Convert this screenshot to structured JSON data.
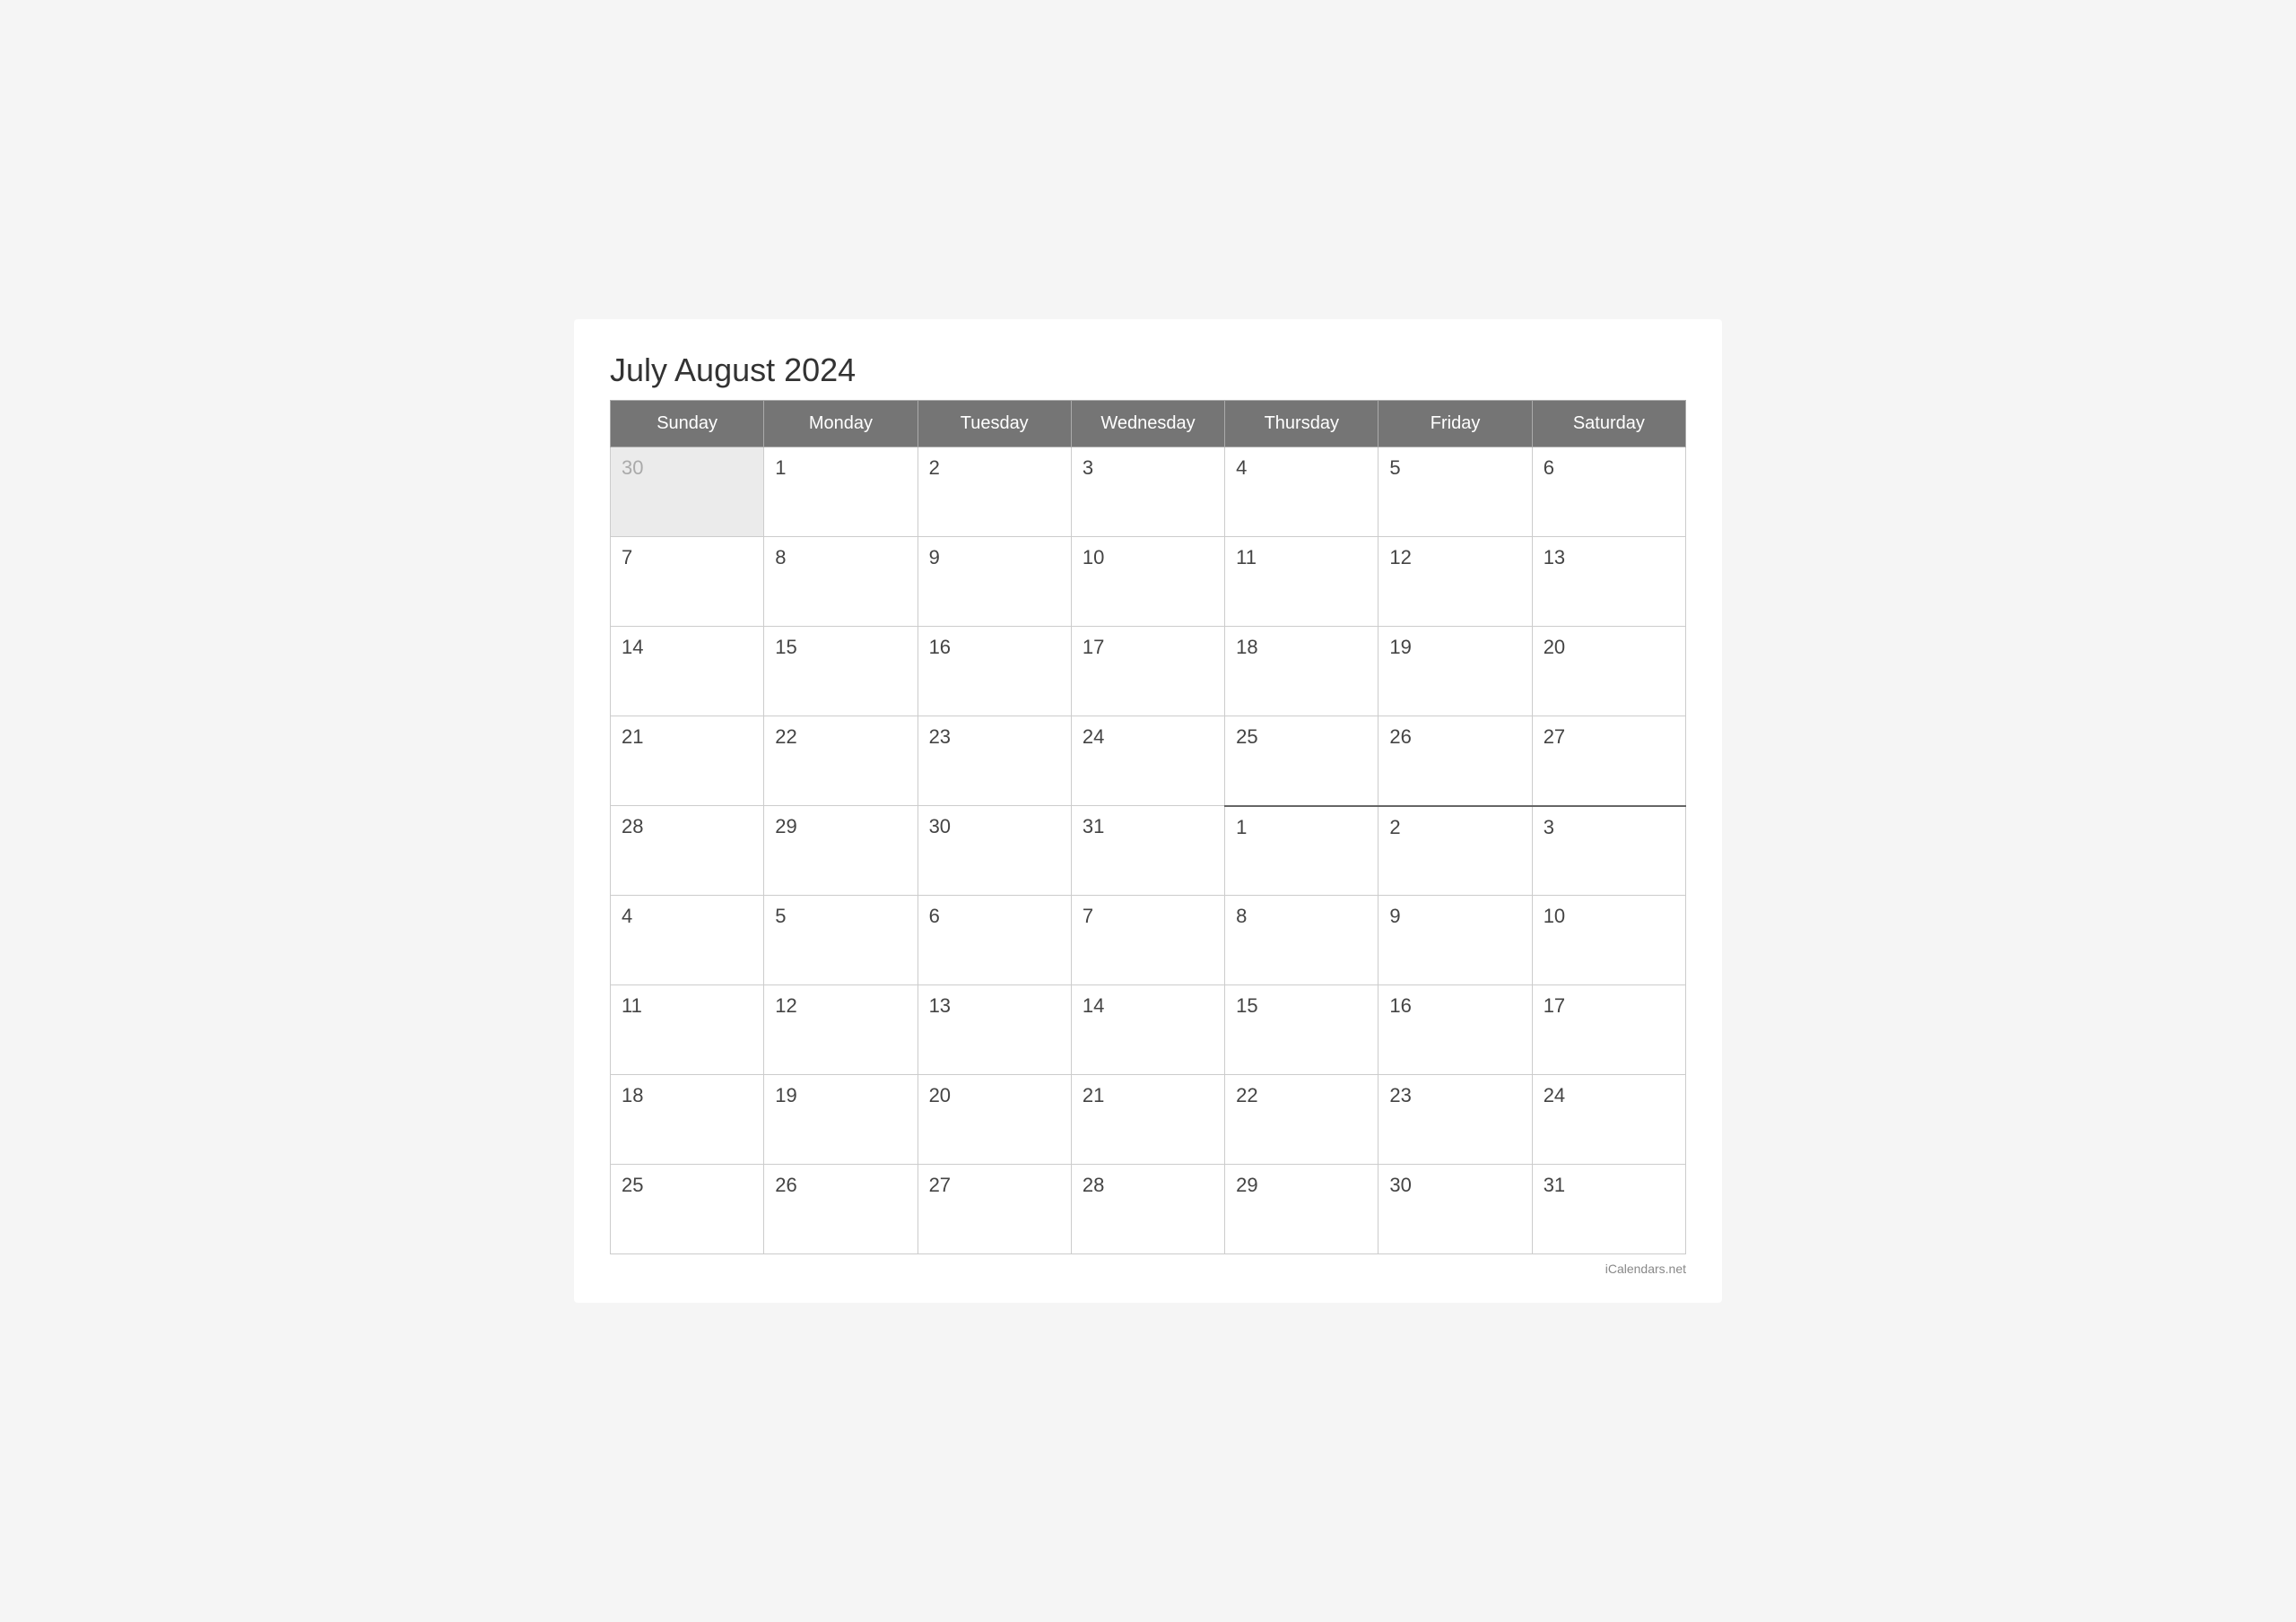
{
  "title": "July August 2024",
  "header": {
    "days": [
      "Sunday",
      "Monday",
      "Tuesday",
      "Wednesday",
      "Thursday",
      "Friday",
      "Saturday"
    ]
  },
  "weeks": [
    [
      {
        "day": "30",
        "otherMonth": true
      },
      {
        "day": "1",
        "otherMonth": false
      },
      {
        "day": "2",
        "otherMonth": false
      },
      {
        "day": "3",
        "otherMonth": false
      },
      {
        "day": "4",
        "otherMonth": false
      },
      {
        "day": "5",
        "otherMonth": false
      },
      {
        "day": "6",
        "otherMonth": false
      }
    ],
    [
      {
        "day": "7",
        "otherMonth": false
      },
      {
        "day": "8",
        "otherMonth": false
      },
      {
        "day": "9",
        "otherMonth": false
      },
      {
        "day": "10",
        "otherMonth": false
      },
      {
        "day": "11",
        "otherMonth": false
      },
      {
        "day": "12",
        "otherMonth": false
      },
      {
        "day": "13",
        "otherMonth": false
      }
    ],
    [
      {
        "day": "14",
        "otherMonth": false
      },
      {
        "day": "15",
        "otherMonth": false
      },
      {
        "day": "16",
        "otherMonth": false
      },
      {
        "day": "17",
        "otherMonth": false
      },
      {
        "day": "18",
        "otherMonth": false
      },
      {
        "day": "19",
        "otherMonth": false
      },
      {
        "day": "20",
        "otherMonth": false
      }
    ],
    [
      {
        "day": "21",
        "otherMonth": false
      },
      {
        "day": "22",
        "otherMonth": false
      },
      {
        "day": "23",
        "otherMonth": false
      },
      {
        "day": "24",
        "otherMonth": false
      },
      {
        "day": "25",
        "otherMonth": false
      },
      {
        "day": "26",
        "otherMonth": false
      },
      {
        "day": "27",
        "otherMonth": false
      }
    ],
    [
      {
        "day": "28",
        "otherMonth": false
      },
      {
        "day": "29",
        "otherMonth": false
      },
      {
        "day": "30",
        "otherMonth": false
      },
      {
        "day": "31",
        "otherMonth": false
      },
      {
        "day": "1",
        "otherMonth": false,
        "augStart": true
      },
      {
        "day": "2",
        "otherMonth": false,
        "augStart": true
      },
      {
        "day": "3",
        "otherMonth": false,
        "augStart": true
      }
    ],
    [
      {
        "day": "4",
        "otherMonth": false
      },
      {
        "day": "5",
        "otherMonth": false
      },
      {
        "day": "6",
        "otherMonth": false
      },
      {
        "day": "7",
        "otherMonth": false
      },
      {
        "day": "8",
        "otherMonth": false
      },
      {
        "day": "9",
        "otherMonth": false
      },
      {
        "day": "10",
        "otherMonth": false
      }
    ],
    [
      {
        "day": "11",
        "otherMonth": false
      },
      {
        "day": "12",
        "otherMonth": false
      },
      {
        "day": "13",
        "otherMonth": false
      },
      {
        "day": "14",
        "otherMonth": false
      },
      {
        "day": "15",
        "otherMonth": false
      },
      {
        "day": "16",
        "otherMonth": false
      },
      {
        "day": "17",
        "otherMonth": false
      }
    ],
    [
      {
        "day": "18",
        "otherMonth": false
      },
      {
        "day": "19",
        "otherMonth": false
      },
      {
        "day": "20",
        "otherMonth": false
      },
      {
        "day": "21",
        "otherMonth": false
      },
      {
        "day": "22",
        "otherMonth": false
      },
      {
        "day": "23",
        "otherMonth": false
      },
      {
        "day": "24",
        "otherMonth": false
      }
    ],
    [
      {
        "day": "25",
        "otherMonth": false
      },
      {
        "day": "26",
        "otherMonth": false
      },
      {
        "day": "27",
        "otherMonth": false
      },
      {
        "day": "28",
        "otherMonth": false
      },
      {
        "day": "29",
        "otherMonth": false
      },
      {
        "day": "30",
        "otherMonth": false
      },
      {
        "day": "31",
        "otherMonth": false
      }
    ]
  ],
  "footer": {
    "text": "iCalendars.net"
  }
}
